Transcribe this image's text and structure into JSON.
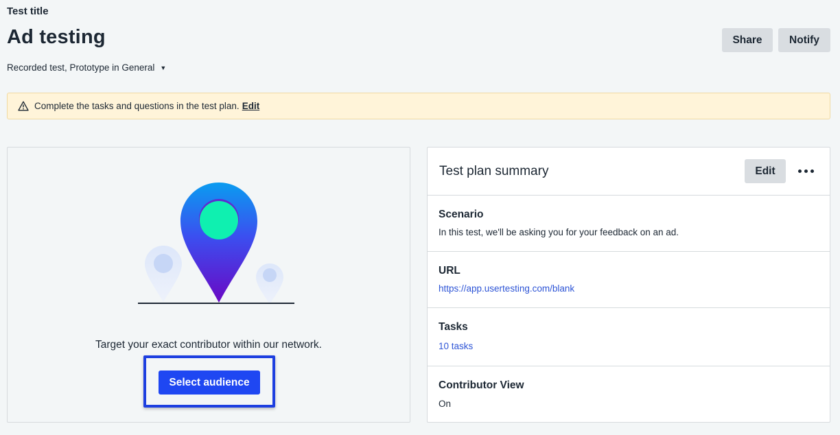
{
  "header": {
    "test_title_label": "Test title",
    "title": "Ad testing",
    "subtitle": "Recorded test, Prototype in General",
    "share_label": "Share",
    "notify_label": "Notify"
  },
  "alert": {
    "message": "Complete the tasks and questions in the test plan.",
    "edit_label": "Edit"
  },
  "audience": {
    "prompt": "Target your exact contributor within our network.",
    "button_label": "Select audience"
  },
  "summary": {
    "title": "Test plan summary",
    "edit_label": "Edit",
    "sections": [
      {
        "label": "Scenario",
        "value": "In this test, we'll be asking you for your feedback on an ad."
      },
      {
        "label": "URL",
        "value": "https://app.usertesting.com/blank"
      },
      {
        "label": "Tasks",
        "value": "10 tasks"
      },
      {
        "label": "Contributor View",
        "value": "On"
      }
    ]
  },
  "colors": {
    "primary": "#1f47f2",
    "link": "#2e55d6",
    "alert_bg": "#fff4d9",
    "text": "#1c2733"
  },
  "icons": [
    "caret-down-icon",
    "warning-icon",
    "location-pin-illustration",
    "more-icon"
  ]
}
